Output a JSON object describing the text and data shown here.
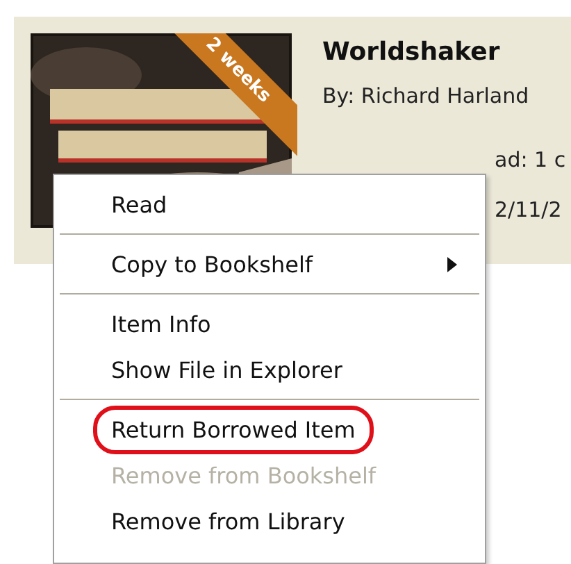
{
  "book": {
    "title": "Worldshaker",
    "author_line": "By:  Richard Harland",
    "ribbon": "2 weeks",
    "details": [
      "ad: 1 c",
      "2/11/2"
    ]
  },
  "context_menu": [
    {
      "kind": "item",
      "label": "Read",
      "disabled": false,
      "circled": false
    },
    {
      "kind": "separator"
    },
    {
      "kind": "submenu",
      "label": "Copy to Bookshelf",
      "disabled": false,
      "circled": false
    },
    {
      "kind": "separator"
    },
    {
      "kind": "item",
      "label": "Item Info",
      "disabled": false,
      "circled": false
    },
    {
      "kind": "item",
      "label": "Show File in Explorer",
      "disabled": false,
      "circled": false
    },
    {
      "kind": "separator"
    },
    {
      "kind": "item",
      "label": "Return Borrowed Item",
      "disabled": false,
      "circled": true
    },
    {
      "kind": "item",
      "label": "Remove from Bookshelf",
      "disabled": true,
      "circled": false
    },
    {
      "kind": "item",
      "label": "Remove from Library",
      "disabled": false,
      "circled": false
    }
  ]
}
